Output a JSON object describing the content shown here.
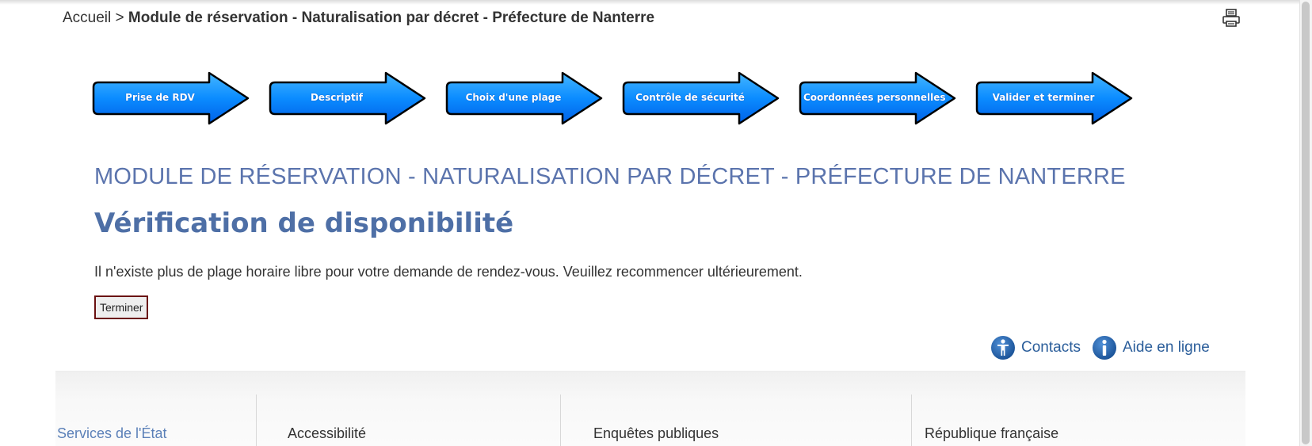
{
  "breadcrumb": {
    "home": "Accueil",
    "separator": ">",
    "current": "Module de réservation - Naturalisation par décret - Préfecture de Nanterre"
  },
  "toolbar": {
    "print_icon": "printer-icon"
  },
  "steps": [
    {
      "label": "Prise de RDV"
    },
    {
      "label": "Descriptif"
    },
    {
      "label": "Choix d'une plage"
    },
    {
      "label": "Contrôle de sécurité"
    },
    {
      "label": "Coordonnées personnelles"
    },
    {
      "label": "Valider et terminer"
    }
  ],
  "main": {
    "module_title": "MODULE DE RÉSERVATION - NATURALISATION PAR DÉCRET - PRÉFECTURE DE NANTERRE",
    "page_title": "Vérification de disponibilité",
    "message": "Il n'existe plus de plage horaire libre pour votre demande de rendez-vous. Veuillez recommencer ultérieurement.",
    "terminer_label": "Terminer"
  },
  "help": {
    "contacts_label": "Contacts",
    "contacts_icon": "accessibility-person-icon",
    "aide_label": "Aide en ligne",
    "aide_icon": "info-icon"
  },
  "footer": {
    "columns": [
      {
        "label": "Services de l'État",
        "color": "#5b80b8"
      },
      {
        "label": "Accessibilité",
        "color": "#333333"
      },
      {
        "label": "Enquêtes publiques",
        "color": "#333333"
      },
      {
        "label": "République française",
        "color": "#333333"
      }
    ]
  },
  "colors": {
    "accent": "#4e6fa6",
    "step_blue": "#0b8cff",
    "link_blue": "#2a5d9a"
  }
}
